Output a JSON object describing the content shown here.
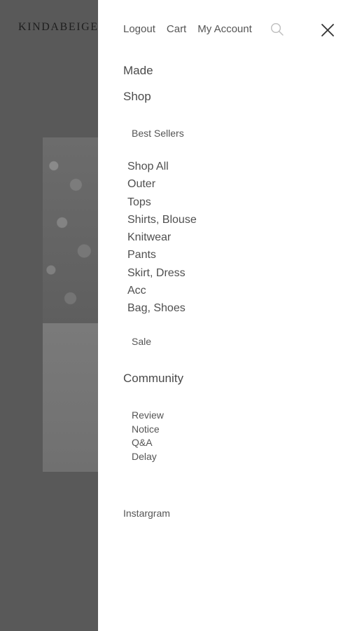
{
  "brand": "KINDABEIGE",
  "topnav": {
    "logout": "Logout",
    "cart": "Cart",
    "account": "My Account"
  },
  "icons": {
    "search": "search-icon",
    "close": "close-icon"
  },
  "menu": {
    "made": "Made",
    "shop": "Shop",
    "best_sellers": "Best Sellers",
    "shop_items": [
      "Shop All",
      "Outer",
      "Tops",
      "Shirts, Blouse",
      "Knitwear",
      "Pants",
      "Skirt, Dress",
      "Acc",
      "Bag, Shoes"
    ],
    "sale": "Sale",
    "community": "Community",
    "community_items": [
      "Review",
      "Notice",
      "Q&A",
      "Delay"
    ],
    "instagram": "Instargram"
  }
}
